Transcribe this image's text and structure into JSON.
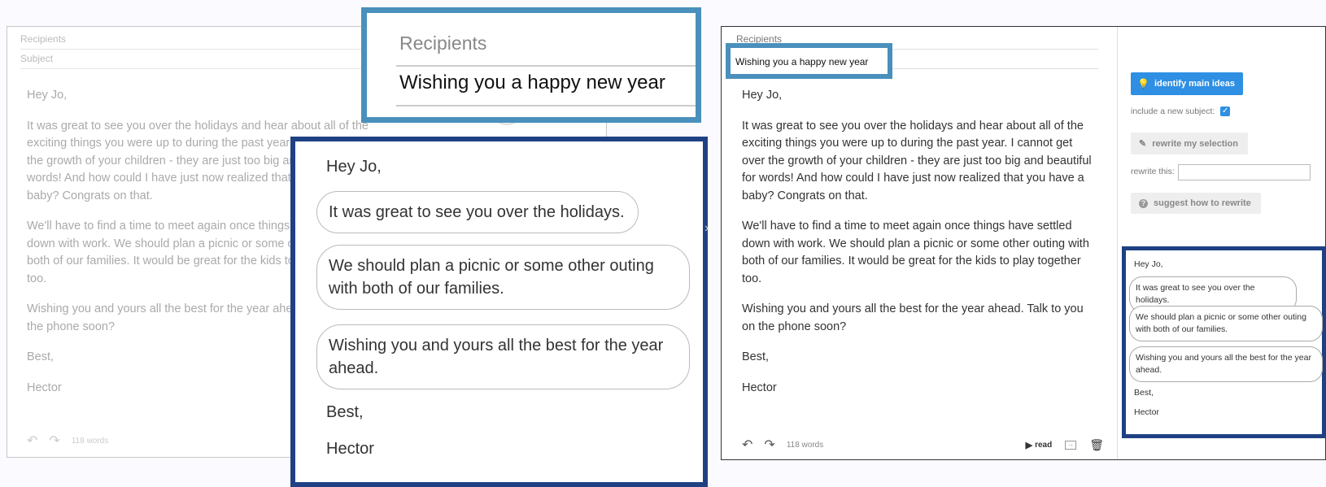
{
  "email": {
    "recipients_label": "Recipients",
    "subject_label": "Subject",
    "subject_value": "Wishing you a happy new year",
    "greeting": "Hey Jo,",
    "paragraph1": "It was great to see you over the holidays and hear about all of the exciting things you were up to during the past year. I cannot get over the growth of your children - they are just too big and beautiful for words! And how could I have just now realized that you have a baby? Congrats on that.",
    "paragraph2": "We'll have to find a time to meet again once things have settled down with work. We should plan a picnic or some other outing with both of our families. It would be great for the kids to play together too.",
    "paragraph3": "Wishing you and yours all the best for the year ahead. Talk to you on the phone soon?",
    "signoff": "Best,",
    "name": "Hector",
    "word_count": "118 words"
  },
  "toolbar": {
    "undo_icon": "undo-icon",
    "redo_icon": "redo-icon",
    "read_label": "read",
    "insert_icon": "insert-icon",
    "trash_icon": "trash-icon"
  },
  "sidebar": {
    "identify_label": "identify main ideas",
    "include_subject_label": "include a new subject:",
    "include_subject_checked": true,
    "rewrite_selection_label": "rewrite my selection",
    "rewrite_this_label": "rewrite this:",
    "rewrite_this_value": "",
    "suggest_label": "suggest how to rewrite"
  },
  "main_ideas": {
    "greeting": "Hey Jo,",
    "ideas": [
      "It was great to see you over the holidays.",
      "We should plan a picnic or some other outing with both of our families.",
      "Wishing you and yours all the best for the year ahead."
    ],
    "signoff": "Best,",
    "name": "Hector"
  },
  "colors": {
    "callout_light": "#4a90bc",
    "callout_dark": "#1f4183",
    "primary_button": "#2e8fe3"
  }
}
